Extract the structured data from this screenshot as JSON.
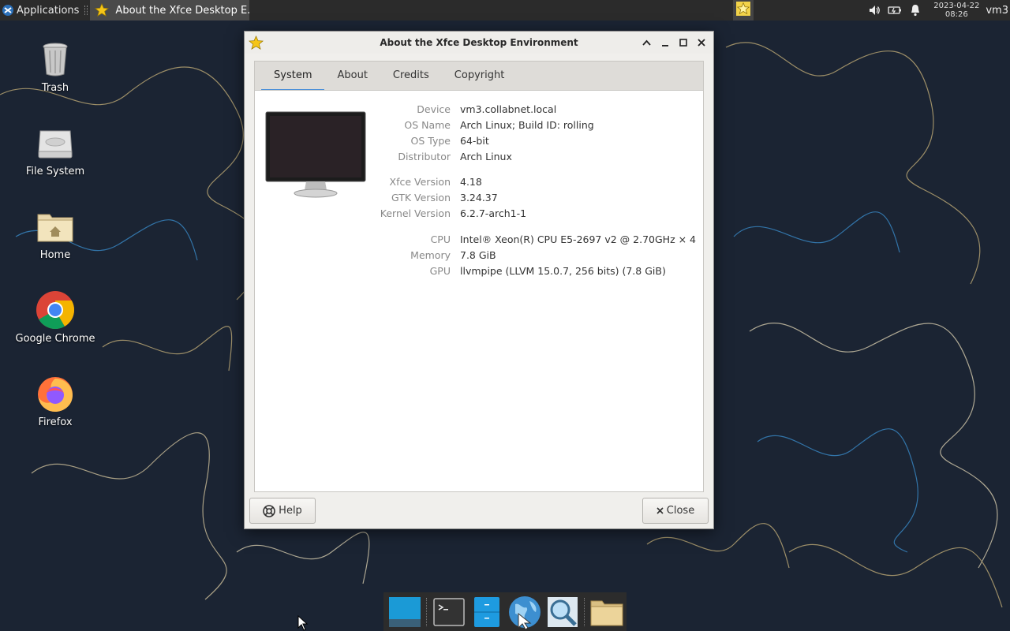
{
  "top_panel": {
    "applications_label": "Applications",
    "task_label": "About the Xfce Desktop E...",
    "clock_date": "2023-04-22",
    "clock_time": "08:26",
    "user_label": "vm3"
  },
  "desktop_icons": [
    {
      "label": "Trash",
      "icon": "trash-icon"
    },
    {
      "label": "File System",
      "icon": "drive-icon"
    },
    {
      "label": "Home",
      "icon": "home-folder-icon"
    },
    {
      "label": "Google Chrome",
      "icon": "chrome-icon"
    },
    {
      "label": "Firefox",
      "icon": "firefox-icon"
    }
  ],
  "dialog": {
    "title": "About the Xfce Desktop Environment",
    "tabs": [
      {
        "label": "System",
        "active": true
      },
      {
        "label": "About",
        "active": false
      },
      {
        "label": "Credits",
        "active": false
      },
      {
        "label": "Copyright",
        "active": false
      }
    ],
    "system_info": {
      "device": {
        "key": "Device",
        "value": "vm3.collabnet.local"
      },
      "os_name": {
        "key": "OS Name",
        "value": "Arch Linux; Build ID: rolling"
      },
      "os_type": {
        "key": "OS Type",
        "value": "64-bit"
      },
      "distributor": {
        "key": "Distributor",
        "value": "Arch Linux"
      },
      "xfce_version": {
        "key": "Xfce Version",
        "value": "4.18"
      },
      "gtk_version": {
        "key": "GTK Version",
        "value": "3.24.37"
      },
      "kernel_version": {
        "key": "Kernel Version",
        "value": "6.2.7-arch1-1"
      },
      "cpu": {
        "key": "CPU",
        "value": "Intel® Xeon(R) CPU E5-2697 v2 @ 2.70GHz × 4"
      },
      "memory": {
        "key": "Memory",
        "value": "7.8 GiB"
      },
      "gpu": {
        "key": "GPU",
        "value": "llvmpipe (LLVM 15.0.7, 256 bits) (7.8 GiB)"
      }
    },
    "help_label": "Help",
    "close_label": "Close"
  },
  "dock": {
    "items": [
      "desktop-icon",
      "terminal-icon",
      "file-manager-icon",
      "web-browser-icon",
      "search-icon",
      "folder-icon"
    ]
  },
  "colors": {
    "accent": "#4a8fd8",
    "panel_bg": "#2b2b2b",
    "wallpaper_bg": "#1b2433"
  }
}
